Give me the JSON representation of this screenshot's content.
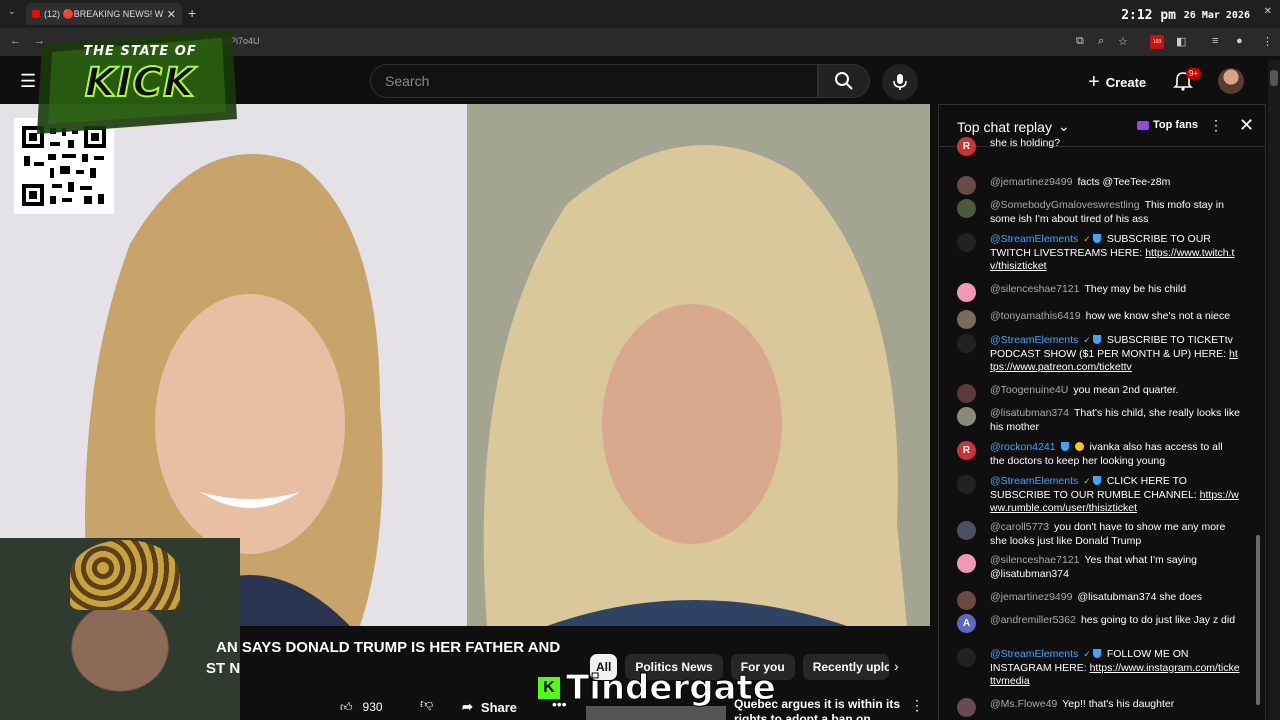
{
  "browser": {
    "tab_title": "(12) 🔴BREAKING NEWS! W",
    "url": "4S7mwPi7o4U",
    "clock": "2:12 pm",
    "date": "26 Mar 2026",
    "ext_badge": "103"
  },
  "logo": {
    "line1": "THE STATE OF",
    "line2": "KICK"
  },
  "header": {
    "search_placeholder": "Search",
    "create_label": "Create",
    "notifications_count": "9+"
  },
  "video": {
    "title_line1": "AN SAYS DONALD TRUMP IS HER FATHER AND",
    "title_line2": "ST N",
    "likes": "930",
    "share_label": "Share",
    "overlay_text": "Tindergate"
  },
  "chips": [
    "All",
    "Politics News",
    "For you",
    "Recently uploa"
  ],
  "recommended": {
    "title": "Quebec argues it is within its rights to adopt a ban on"
  },
  "chat": {
    "mode_label": "Top chat replay",
    "topfans_label": "Top fans",
    "messages": [
      {
        "author": "",
        "text": "she is holding?",
        "color": "#cc3333",
        "letter": "R"
      },
      {
        "author": "@jemartinez9499",
        "text": "facts @TeeTee-z8m",
        "color": "#6a4a42"
      },
      {
        "author": "@SomebodyGmaloveswrestling",
        "text": "This mofo stay in some ish I'm about tired of his ass",
        "color": "#4a5a3a"
      },
      {
        "author": "@StreamElements",
        "text": "SUBSCRIBE TO OUR TWITCH LIVESTREAMS HERE:",
        "link": "https://www.twitch.tv/thisizticket",
        "color": "#222222"
      },
      {
        "author": "@silenceshae7121",
        "text": "They may be his child",
        "color": "#f29ab5"
      },
      {
        "author": "@tonyamathis6419",
        "text": "how we know she's not a niece",
        "color": "#7a6a5a"
      },
      {
        "author": "@StreamElements",
        "text": "SUBSCRIBE TO TICKETtv PODCAST SHOW ($1 PER MONTH & UP) HERE:",
        "link": "https://www.patreon.com/tickettv",
        "color": "#222222"
      },
      {
        "author": "@Toogenuine4U",
        "text": "you mean 2nd quarter.",
        "color": "#5a3a3a"
      },
      {
        "author": "@lisatubman374",
        "text": "That's his child, she really looks like his mother",
        "color": "#8a8a7a"
      },
      {
        "author": "@rockon4241",
        "text": "ivanka also has access to all the doctors to keep her looking young",
        "color": "#cc3333",
        "letter": "R"
      },
      {
        "author": "@StreamElements",
        "text": "CLICK HERE TO SUBSCRIBE TO OUR RUMBLE CHANNEL:",
        "link": "https://www.rumble.com/user/thisizticket",
        "color": "#222222"
      },
      {
        "author": "@caroll5773",
        "text": "you don't have to show me any more she looks just like Donald Trump",
        "color": "#4a5060"
      },
      {
        "author": "@silenceshae7121",
        "text": "Yes that what I'm saying @lisatubman374",
        "color": "#f29ab5"
      },
      {
        "author": "@jemartinez9499",
        "text": "@lisatubman374 she does",
        "color": "#6a4a42"
      },
      {
        "author": "@andremiller5362",
        "text": "hes going to do just like Jay z did",
        "color": "#5c6bc0",
        "letter": "A"
      },
      {
        "author": "@StreamElements",
        "text": "FOLLOW ME ON INSTAGRAM HERE:",
        "link": "https://www.instagram.com/tickettvmedia",
        "color": "#222222"
      },
      {
        "author": "@Ms.Flowe49",
        "text": "Yep!! that's his daughter",
        "color": "#6a4a52"
      }
    ]
  }
}
